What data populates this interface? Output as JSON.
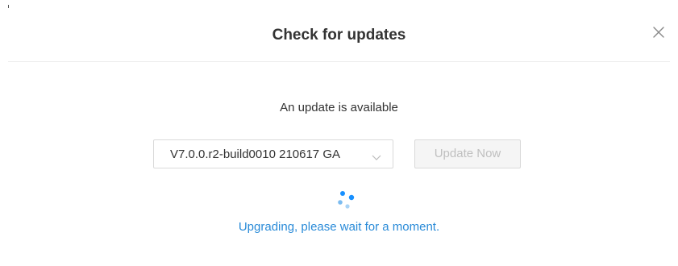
{
  "dialog": {
    "title": "Check for updates",
    "close_icon": "close-icon",
    "message": "An update is available",
    "version_select": {
      "selected": "V7.0.0.r2-build0010 210617 GA",
      "arrow_icon": "chevron-down-icon"
    },
    "update_button": {
      "label": "Update Now",
      "disabled": true
    },
    "spinner_icon": "loading-spinner-icon",
    "status_text": "Upgrading, please wait for a moment."
  },
  "colors": {
    "accent": "#2a8bd8",
    "spinner": "#1890ff",
    "title_text": "#333333",
    "disabled_text": "#bfbfbf",
    "border": "#d9d9d9"
  }
}
